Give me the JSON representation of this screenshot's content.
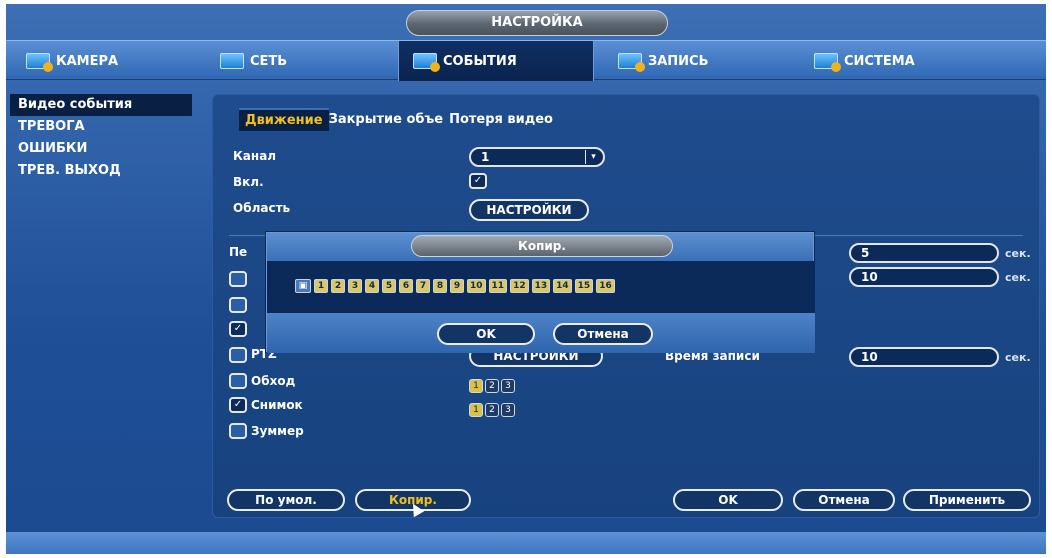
{
  "window": {
    "title": "НАСТРОЙКА"
  },
  "tabs": [
    {
      "label": "КАМЕРА",
      "icon": "camera-icon"
    },
    {
      "label": "СЕТЬ",
      "icon": "network-icon"
    },
    {
      "label": "СОБЫТИЯ",
      "icon": "events-icon",
      "active": true
    },
    {
      "label": "ЗАПИСЬ",
      "icon": "record-icon"
    },
    {
      "label": "СИСТЕМА",
      "icon": "system-icon"
    }
  ],
  "sidebar": {
    "items": [
      {
        "label": "Видео события",
        "active": true
      },
      {
        "label": "ТРЕВОГА"
      },
      {
        "label": "ОШИБКИ"
      },
      {
        "label": "ТРЕВ. ВЫХОД"
      }
    ]
  },
  "subtabs": [
    "Движение",
    "Закрытие объе",
    "Потеря видео"
  ],
  "form": {
    "channel_label": "Канал",
    "channel_value": "1",
    "enable_label": "Вкл.",
    "area_label": "Область",
    "area_button": "НАСТРОЙКИ",
    "period_label_partial": "Пе",
    "sec_values": [
      "5",
      "10"
    ],
    "sec_unit": "сек.",
    "ptz_label": "PTZ",
    "ptz_button": "НАСТРОЙКИ",
    "record_time_label": "Время записи",
    "record_time_value": "10",
    "tour_label": "Обход",
    "snapshot_label": "Снимок",
    "buzzer_label": "Зуммер",
    "tour_channels": [
      "1",
      "2",
      "3"
    ],
    "snapshot_channels": [
      "1",
      "2",
      "3"
    ]
  },
  "modal": {
    "title": "Копир.",
    "channels": [
      "1",
      "2",
      "3",
      "4",
      "5",
      "6",
      "7",
      "8",
      "9",
      "10",
      "11",
      "12",
      "13",
      "14",
      "15",
      "16"
    ],
    "ok": "OK",
    "cancel": "Отмена"
  },
  "footer": {
    "default": "По умол.",
    "copy": "Копир.",
    "ok": "OK",
    "cancel": "Отмена",
    "apply": "Применить"
  }
}
